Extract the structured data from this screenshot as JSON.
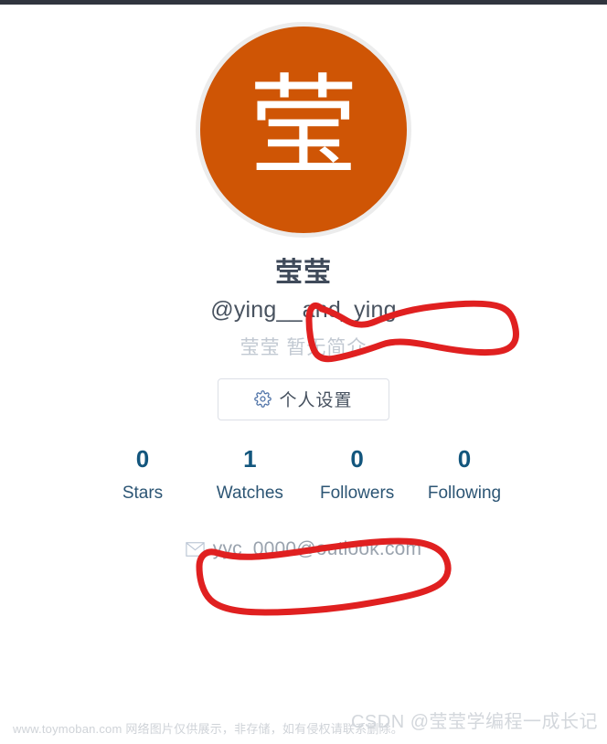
{
  "profile": {
    "avatar": {
      "initial": "莹",
      "background_color": "#cf5505",
      "ring_color": "#ececec"
    },
    "display_name": "莹莹",
    "username_handle": "@ying__and_ying",
    "bio": "莹莹 暂无简介",
    "settings_button": {
      "label": "个人设置",
      "icon": "gear-icon"
    },
    "stats": [
      {
        "value": "0",
        "label": "Stars"
      },
      {
        "value": "1",
        "label": "Watches"
      },
      {
        "value": "0",
        "label": "Followers"
      },
      {
        "value": "0",
        "label": "Following"
      }
    ],
    "contact": {
      "icon": "mail-icon",
      "email": "yyc_0000@outlook.com"
    }
  },
  "annotations": {
    "color": "#e02020",
    "items": [
      {
        "name": "username-highlight-circle",
        "target": "username_handle"
      },
      {
        "name": "email-highlight-circle",
        "target": "email"
      }
    ]
  },
  "footer": {
    "left_watermark": "www.toymoban.com 网络图片仅供展示，非存储，如有侵权请联系删除。",
    "right_watermark": "CSDN @莹莹学编程一成长记"
  },
  "theme": {
    "top_bar_color": "#30353e",
    "stat_value_color": "#13567d",
    "stat_label_color": "#2c5574",
    "name_color": "#3f4a5a",
    "bio_color": "#c2c9d2",
    "email_color": "#9aa3ae"
  }
}
